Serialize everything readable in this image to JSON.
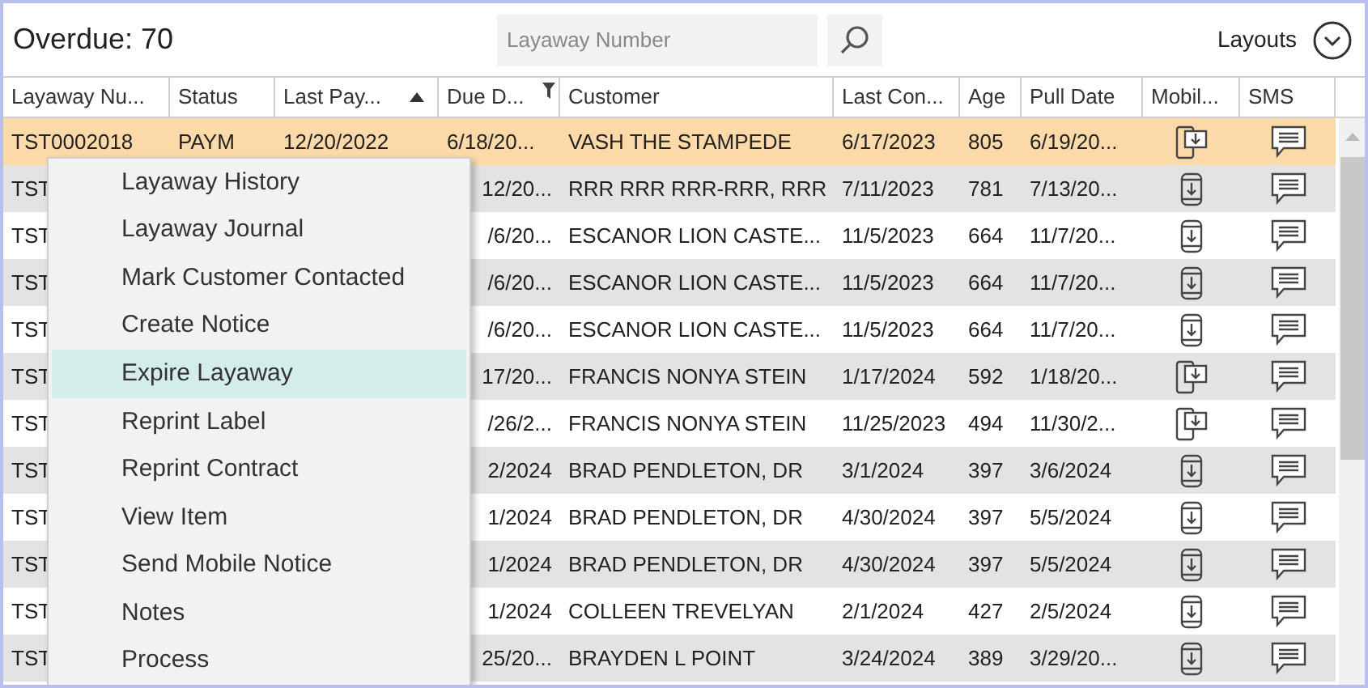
{
  "header": {
    "overdue": "Overdue: 70",
    "search": {
      "placeholder": "Layaway Number"
    },
    "layouts": "Layouts"
  },
  "columns": [
    {
      "label": "Layaway Nu...",
      "sorted_ascending": false,
      "filter": false
    },
    {
      "label": "Status",
      "sorted_ascending": false,
      "filter": false
    },
    {
      "label": "Last Pay...",
      "sorted_ascending": true,
      "filter": false
    },
    {
      "label": "Due D...",
      "sorted_ascending": false,
      "filter": true
    },
    {
      "label": "Customer",
      "sorted_ascending": false,
      "filter": false
    },
    {
      "label": "Last Con...",
      "sorted_ascending": false,
      "filter": false
    },
    {
      "label": "Age",
      "sorted_ascending": false,
      "filter": false
    },
    {
      "label": "Pull Date",
      "sorted_ascending": false,
      "filter": false
    },
    {
      "label": "Mobil...",
      "sorted_ascending": false,
      "filter": false
    },
    {
      "label": "SMS",
      "sorted_ascending": false,
      "filter": false
    }
  ],
  "rows": [
    {
      "selected": true,
      "layaway": "TST0002018",
      "status": "PAYM",
      "last_payment": "12/20/2022",
      "due": "6/18/20...",
      "customer": "VASH THE STAMPEDE",
      "last_contact": "6/17/2023",
      "age": "805",
      "pull_date": "6/19/20...",
      "mobile": {
        "kind": "phone-out"
      }
    },
    {
      "selected": false,
      "layaway": "TST",
      "due": "12/20...",
      "customer": "RRR RRR RRR-RRR, RRR",
      "last_contact": "7/11/2023",
      "age": "781",
      "pull_date": "7/13/20...",
      "mobile": {
        "kind": "phone-in"
      }
    },
    {
      "selected": false,
      "layaway": "TST",
      "due": "/6/20...",
      "customer": "ESCANOR LION CASTE...",
      "last_contact": "11/5/2023",
      "age": "664",
      "pull_date": "11/7/20...",
      "mobile": {
        "kind": "phone-in"
      }
    },
    {
      "selected": false,
      "layaway": "TST",
      "due": "/6/20...",
      "customer": "ESCANOR LION CASTE...",
      "last_contact": "11/5/2023",
      "age": "664",
      "pull_date": "11/7/20...",
      "mobile": {
        "kind": "phone-in"
      }
    },
    {
      "selected": false,
      "layaway": "TST",
      "due": "/6/20...",
      "customer": "ESCANOR LION CASTE...",
      "last_contact": "11/5/2023",
      "age": "664",
      "pull_date": "11/7/20...",
      "mobile": {
        "kind": "phone-in"
      }
    },
    {
      "selected": false,
      "layaway": "TST",
      "due": "17/20...",
      "customer": "FRANCIS NONYA STEIN",
      "last_contact": "1/17/2024",
      "age": "592",
      "pull_date": "1/18/20...",
      "mobile": {
        "kind": "phone-out"
      }
    },
    {
      "selected": false,
      "layaway": "TST",
      "due": "/26/2...",
      "customer": "FRANCIS NONYA STEIN",
      "last_contact": "11/25/2023",
      "age": "494",
      "pull_date": "11/30/2...",
      "mobile": {
        "kind": "phone-out"
      }
    },
    {
      "selected": false,
      "layaway": "TST",
      "due": "2/2024",
      "customer": "BRAD PENDLETON, DR",
      "last_contact": "3/1/2024",
      "age": "397",
      "pull_date": "3/6/2024",
      "mobile": {
        "kind": "phone-in"
      }
    },
    {
      "selected": false,
      "layaway": "TST",
      "due": "1/2024",
      "customer": "BRAD PENDLETON, DR",
      "last_contact": "4/30/2024",
      "age": "397",
      "pull_date": "5/5/2024",
      "mobile": {
        "kind": "phone-in"
      }
    },
    {
      "selected": false,
      "layaway": "TST",
      "due": "1/2024",
      "customer": "BRAD PENDLETON, DR",
      "last_contact": "4/30/2024",
      "age": "397",
      "pull_date": "5/5/2024",
      "mobile": {
        "kind": "phone-in"
      }
    },
    {
      "selected": false,
      "layaway": "TST",
      "due": "1/2024",
      "customer": "COLLEEN TREVELYAN",
      "last_contact": "2/1/2024",
      "age": "427",
      "pull_date": "2/5/2024",
      "mobile": {
        "kind": "phone-in"
      }
    },
    {
      "selected": false,
      "layaway": "TST",
      "due": "25/20...",
      "customer": "BRAYDEN L POINT",
      "last_contact": "3/24/2024",
      "age": "389",
      "pull_date": "3/29/20...",
      "mobile": {
        "kind": "phone-in"
      }
    }
  ],
  "context_menu": [
    {
      "label": "Layaway History",
      "selected": false
    },
    {
      "label": "Layaway Journal",
      "selected": false
    },
    {
      "label": "Mark Customer Contacted",
      "selected": false
    },
    {
      "label": "Create Notice",
      "selected": false
    },
    {
      "label": "Expire Layaway",
      "selected": true
    },
    {
      "label": "Reprint Label",
      "selected": false
    },
    {
      "label": "Reprint Contract",
      "selected": false
    },
    {
      "label": "View Item",
      "selected": false
    },
    {
      "label": "Send Mobile Notice",
      "selected": false
    },
    {
      "label": "Notes",
      "selected": false
    },
    {
      "label": "Process",
      "selected": false
    }
  ]
}
